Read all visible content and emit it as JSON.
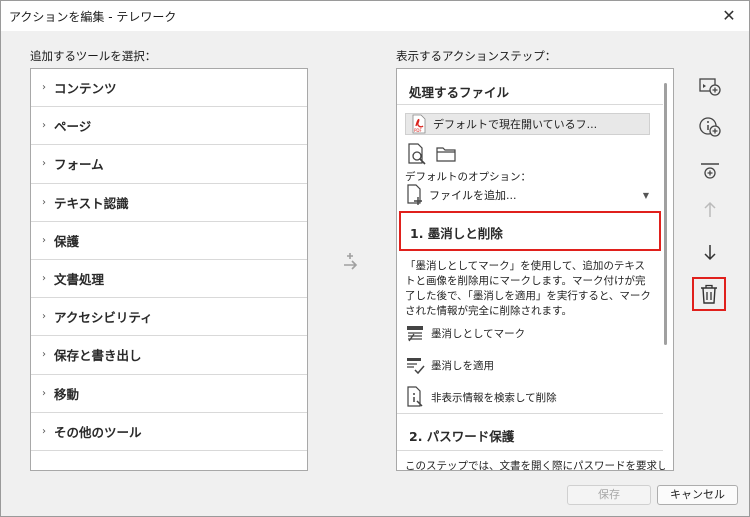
{
  "window": {
    "title": "アクションを編集 - テレワーク",
    "close_glyph": "✕"
  },
  "left": {
    "label": "追加するツールを選択：",
    "categories": [
      "コンテンツ",
      "ページ",
      "フォーム",
      "テキスト認識",
      "保護",
      "文書処理",
      "アクセシビリティ",
      "保存と書き出し",
      "移動",
      "その他のツール"
    ]
  },
  "right": {
    "label": "表示するアクションステップ：",
    "file_section_title": "処理するファイル",
    "file_item": "デフォルトで現在開いているフ...",
    "default_options_label": "デフォルトのオプション：",
    "add_file": "ファイルを追加...",
    "step1_title": "1. 墨消しと削除",
    "step1_desc": "「墨消しとしてマーク」を使用して、追加のテキストと画像を削除用にマークします。マーク付けが完了した後で、「墨消しを適用」を実行すると、マークされた情報が完全に削除されます。",
    "actions": [
      "墨消しとしてマーク",
      "墨消しを適用",
      "非表示情報を検索して削除"
    ],
    "step2_title": "2. パスワード保護",
    "step2_desc": "このステップでは、文書を開く際にパスワードを要求した"
  },
  "toolbar": {
    "icons": [
      "add-step-icon",
      "add-instruction-icon",
      "add-separator-icon",
      "move-up-icon",
      "move-down-icon",
      "delete-icon"
    ]
  },
  "buttons": {
    "save": "保存",
    "cancel": "キャンセル"
  },
  "colors": {
    "highlight": "#e0201c",
    "pdf_red": "#d9221c",
    "window_bg": "#f0f0f0"
  }
}
